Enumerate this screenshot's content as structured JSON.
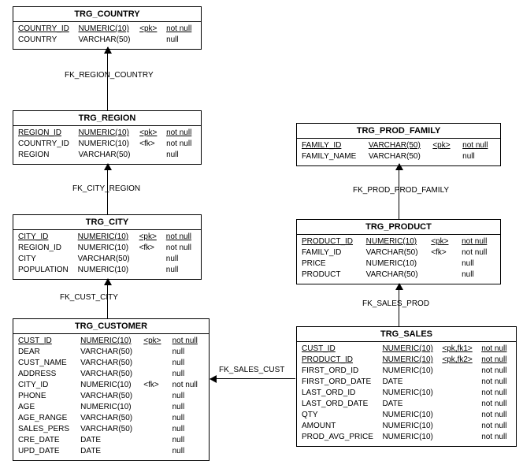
{
  "entities": {
    "trg_country": {
      "title": "TRG_COUNTRY",
      "cols": [
        {
          "name": "COUNTRY_ID",
          "type": "NUMERIC(10)",
          "key": "<pk>",
          "null": "not null",
          "pk": true
        },
        {
          "name": "COUNTRY",
          "type": "VARCHAR(50)",
          "key": "",
          "null": "null",
          "pk": false
        }
      ]
    },
    "trg_region": {
      "title": "TRG_REGION",
      "cols": [
        {
          "name": "REGION_ID",
          "type": "NUMERIC(10)",
          "key": "<pk>",
          "null": "not null",
          "pk": true
        },
        {
          "name": "COUNTRY_ID",
          "type": "NUMERIC(10)",
          "key": "<fk>",
          "null": "not null",
          "pk": false
        },
        {
          "name": "REGION",
          "type": "VARCHAR(50)",
          "key": "",
          "null": "null",
          "pk": false
        }
      ]
    },
    "trg_city": {
      "title": "TRG_CITY",
      "cols": [
        {
          "name": "CITY_ID",
          "type": "NUMERIC(10)",
          "key": "<pk>",
          "null": "not null",
          "pk": true
        },
        {
          "name": "REGION_ID",
          "type": "NUMERIC(10)",
          "key": "<fk>",
          "null": "not null",
          "pk": false
        },
        {
          "name": "CITY",
          "type": "VARCHAR(50)",
          "key": "",
          "null": "null",
          "pk": false
        },
        {
          "name": "POPULATION",
          "type": "NUMERIC(10)",
          "key": "",
          "null": "null",
          "pk": false
        }
      ]
    },
    "trg_customer": {
      "title": "TRG_CUSTOMER",
      "cols": [
        {
          "name": "CUST_ID",
          "type": "NUMERIC(10)",
          "key": "<pk>",
          "null": "not null",
          "pk": true
        },
        {
          "name": "DEAR",
          "type": "VARCHAR(50)",
          "key": "",
          "null": "null",
          "pk": false
        },
        {
          "name": "CUST_NAME",
          "type": "VARCHAR(50)",
          "key": "",
          "null": "null",
          "pk": false
        },
        {
          "name": "ADDRESS",
          "type": "VARCHAR(50)",
          "key": "",
          "null": "null",
          "pk": false
        },
        {
          "name": "CITY_ID",
          "type": "NUMERIC(10)",
          "key": "<fk>",
          "null": "not null",
          "pk": false
        },
        {
          "name": "PHONE",
          "type": "VARCHAR(50)",
          "key": "",
          "null": "null",
          "pk": false
        },
        {
          "name": "AGE",
          "type": "NUMERIC(10)",
          "key": "",
          "null": "null",
          "pk": false
        },
        {
          "name": "AGE_RANGE",
          "type": "VARCHAR(50)",
          "key": "",
          "null": "null",
          "pk": false
        },
        {
          "name": "SALES_PERS",
          "type": "VARCHAR(50)",
          "key": "",
          "null": "null",
          "pk": false
        },
        {
          "name": "CRE_DATE",
          "type": "DATE",
          "key": "",
          "null": "null",
          "pk": false
        },
        {
          "name": "UPD_DATE",
          "type": "DATE",
          "key": "",
          "null": "null",
          "pk": false
        }
      ]
    },
    "trg_prod_family": {
      "title": "TRG_PROD_FAMILY",
      "cols": [
        {
          "name": "FAMILY_ID",
          "type": "VARCHAR(50)",
          "key": "<pk>",
          "null": "not null",
          "pk": true
        },
        {
          "name": "FAMILY_NAME",
          "type": "VARCHAR(50)",
          "key": "",
          "null": "null",
          "pk": false
        }
      ]
    },
    "trg_product": {
      "title": "TRG_PRODUCT",
      "cols": [
        {
          "name": "PRODUCT_ID",
          "type": "NUMERIC(10)",
          "key": "<pk>",
          "null": "not null",
          "pk": true
        },
        {
          "name": "FAMILY_ID",
          "type": "VARCHAR(50)",
          "key": "<fk>",
          "null": "not null",
          "pk": false
        },
        {
          "name": "PRICE",
          "type": "NUMERIC(10)",
          "key": "",
          "null": "null",
          "pk": false
        },
        {
          "name": "PRODUCT",
          "type": "VARCHAR(50)",
          "key": "",
          "null": "null",
          "pk": false
        }
      ]
    },
    "trg_sales": {
      "title": "TRG_SALES",
      "cols": [
        {
          "name": "CUST_ID",
          "type": "NUMERIC(10)",
          "key": "<pk,fk1>",
          "null": "not null",
          "pk": true
        },
        {
          "name": "PRODUCT_ID",
          "type": "NUMERIC(10)",
          "key": "<pk,fk2>",
          "null": "not null",
          "pk": true
        },
        {
          "name": "FIRST_ORD_ID",
          "type": "NUMERIC(10)",
          "key": "",
          "null": "not null",
          "pk": false
        },
        {
          "name": "FIRST_ORD_DATE",
          "type": "DATE",
          "key": "",
          "null": "not null",
          "pk": false
        },
        {
          "name": "LAST_ORD_ID",
          "type": "NUMERIC(10)",
          "key": "",
          "null": "not null",
          "pk": false
        },
        {
          "name": "LAST_ORD_DATE",
          "type": "DATE",
          "key": "",
          "null": "not null",
          "pk": false
        },
        {
          "name": "QTY",
          "type": "NUMERIC(10)",
          "key": "",
          "null": "not null",
          "pk": false
        },
        {
          "name": "AMOUNT",
          "type": "NUMERIC(10)",
          "key": "",
          "null": "not null",
          "pk": false
        },
        {
          "name": "PROD_AVG_PRICE",
          "type": "NUMERIC(10)",
          "key": "",
          "null": "not null",
          "pk": false
        }
      ]
    }
  },
  "rels": {
    "r1": "FK_REGION_COUNTRY",
    "r2": "FK_CITY_REGION",
    "r3": "FK_CUST_CITY",
    "r4": "FK_PROD_PROD_FAMILY",
    "r5": "FK_SALES_PROD",
    "r6": "FK_SALES_CUST"
  }
}
